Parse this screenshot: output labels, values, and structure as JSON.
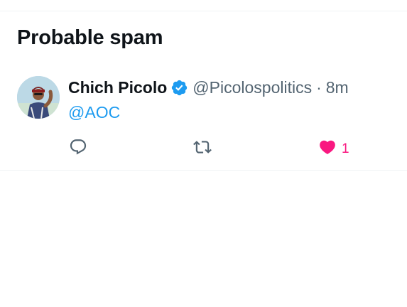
{
  "section": {
    "title": "Probable spam"
  },
  "tweet": {
    "display_name": "Chich Picolo",
    "verified_icon": "verified-badge-icon",
    "handle": "@Picolospolitics",
    "separator": "·",
    "time": "8m",
    "text": "@AOC",
    "mention_color": "#1d9bf0",
    "actions": {
      "reply_icon": "reply-icon",
      "retweet_icon": "retweet-icon",
      "like_icon": "heart-filled-icon",
      "like_count": "1",
      "like_color": "#f91880"
    }
  }
}
